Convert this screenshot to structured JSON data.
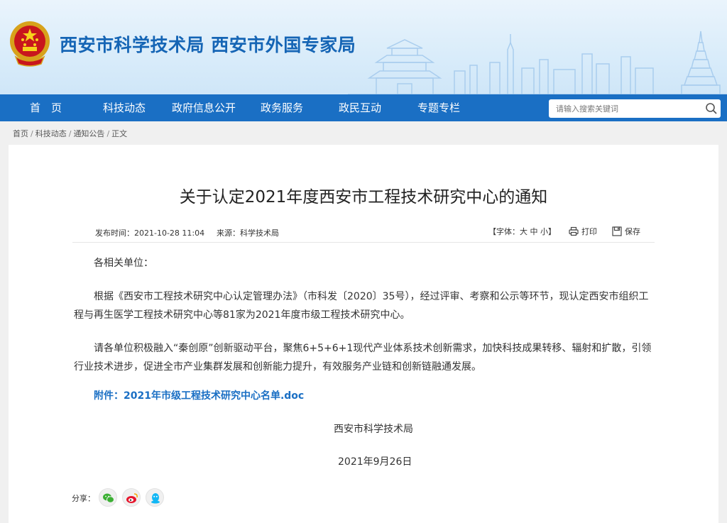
{
  "header": {
    "site_title": "西安市科学技术局  西安市外国专家局",
    "brand_color": "#1a6fc4",
    "emblem_icon": "national-emblem-icon"
  },
  "nav": {
    "items": [
      {
        "label": "首　页"
      },
      {
        "label": "科技动态"
      },
      {
        "label": "政府信息公开"
      },
      {
        "label": "政务服务"
      },
      {
        "label": "政民互动"
      },
      {
        "label": "专题专栏"
      }
    ],
    "search": {
      "placeholder": "请输入搜索关键词",
      "icon": "search-icon"
    }
  },
  "breadcrumb": {
    "items": [
      {
        "label": "首页"
      },
      {
        "label": "科技动态"
      },
      {
        "label": "通知公告"
      },
      {
        "label": "正文"
      }
    ],
    "separator": "/"
  },
  "article": {
    "title": "关于认定2021年度西安市工程技术研究中心的通知",
    "meta": {
      "publish_time": "发布时间：2021-10-28 11:04",
      "source": "来源：科学技术局",
      "font_size_label": "【字体：",
      "font_large": "大",
      "font_medium": "中",
      "font_small": "小",
      "font_close": "】",
      "print_label": "打印",
      "save_label": "保存"
    },
    "salutation": "各相关单位：",
    "paragraph1": "根据《西安市工程技术研究中心认定管理办法》（市科发〔2020〕35号），经过评审、考察和公示等环节，现认定西安市组织工程与再生医学工程技术研究中心等81家为2021年度市级工程技术研究中心。",
    "paragraph2": "请各单位积极融入“秦创原”创新驱动平台，聚焦6+5+6+1现代产业体系技术创新需求，加快科技成果转移、辐射和扩散，引领行业技术进步，促进全市产业集群发展和创新能力提升，有效服务产业链和创新链融通发展。",
    "attachment_prefix": "附件：",
    "attachment_link": "2021年市级工程技术研究中心名单.doc",
    "signature": "西安市科学技术局",
    "date": "2021年9月26日"
  },
  "share": {
    "label": "分享：",
    "buttons": [
      {
        "icon": "wechat-icon",
        "color": "#3cb034"
      },
      {
        "icon": "weibo-icon",
        "color": "#e6162d"
      },
      {
        "icon": "qq-icon",
        "color": "#12b7f5"
      }
    ]
  }
}
